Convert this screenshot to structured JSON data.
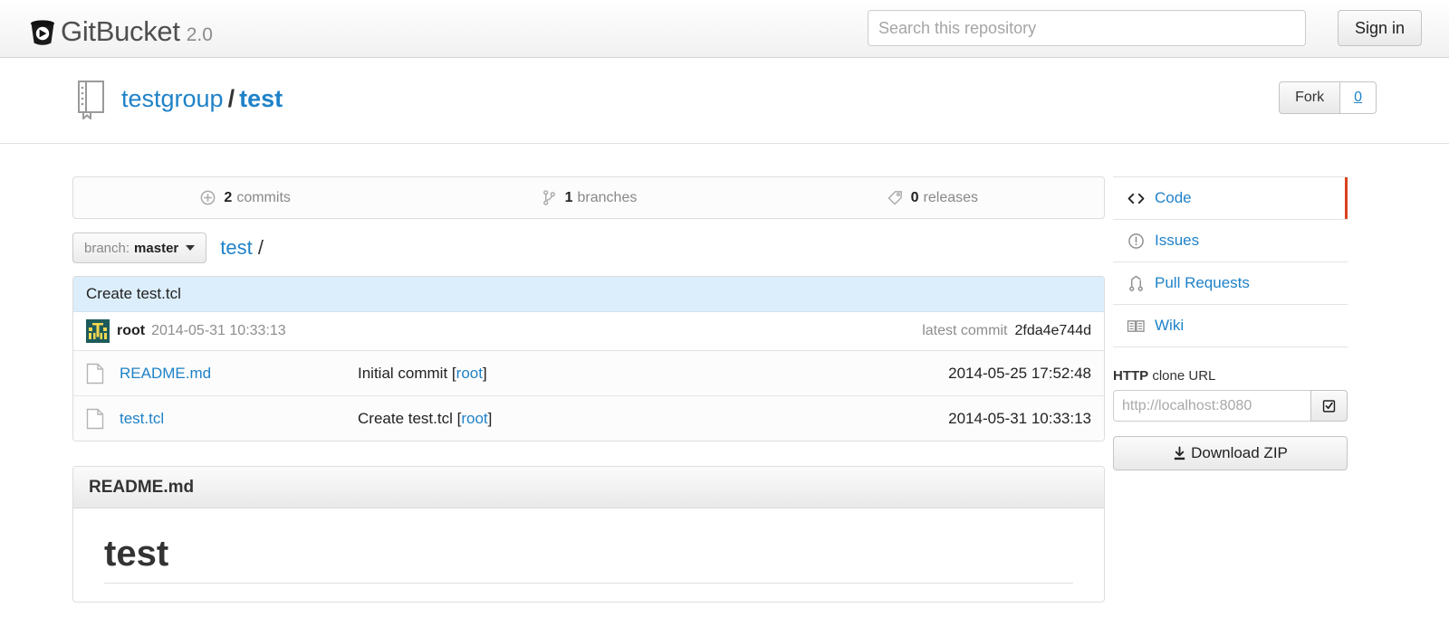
{
  "header": {
    "brand_name": "GitBucket",
    "brand_version": "2.0",
    "logo_icon": "gitbucket-logo-icon",
    "search_placeholder": "Search this repository",
    "search_value": "",
    "signin_label": "Sign in"
  },
  "repo": {
    "icon": "repository-book-icon",
    "owner": "testgroup",
    "separator": "/",
    "name": "test",
    "fork_label": "Fork",
    "fork_count": "0"
  },
  "stats": [
    {
      "icon": "commit-clock-icon",
      "count": "2",
      "label": "commits"
    },
    {
      "icon": "branch-icon",
      "count": "1",
      "label": "branches"
    },
    {
      "icon": "tag-icon",
      "count": "0",
      "label": "releases"
    }
  ],
  "branch_bar": {
    "prefix": "branch:",
    "branch": "master",
    "path_root": "test",
    "path_slash": "/"
  },
  "commit": {
    "message": "Create test.tcl",
    "avatar_icon": "identicon-avatar",
    "author": "root",
    "date": "2014-05-31 10:33:13",
    "latest_commit_label": "latest commit",
    "latest_commit_hash": "2fda4e744d"
  },
  "files": {
    "rows": [
      {
        "icon": "file-icon",
        "name": "README.md",
        "message": "Initial commit ",
        "message_author_open": "[",
        "message_author": "root",
        "message_author_close": "]",
        "date": "2014-05-25 17:52:48"
      },
      {
        "icon": "file-icon",
        "name": "test.tcl",
        "message": "Create test.tcl ",
        "message_author_open": "[",
        "message_author": "root",
        "message_author_close": "]",
        "date": "2014-05-31 10:33:13"
      }
    ]
  },
  "readme": {
    "title": "README.md",
    "heading": "test"
  },
  "sidebar": {
    "items": [
      {
        "icon": "code-brackets-icon",
        "label": "Code",
        "active": true
      },
      {
        "icon": "issue-exclamation-icon",
        "label": "Issues",
        "active": false
      },
      {
        "icon": "pull-request-icon",
        "label": "Pull Requests",
        "active": false
      },
      {
        "icon": "wiki-book-icon",
        "label": "Wiki",
        "active": false
      }
    ],
    "clone": {
      "label_bold": "HTTP",
      "label_rest": " clone URL",
      "url_value": "http://localhost:8080",
      "copy_icon": "clipboard-check-icon"
    },
    "download": {
      "icon": "download-icon",
      "label": "Download ZIP"
    }
  },
  "colors": {
    "link": "#1f82c8",
    "active_marker": "#d9411e",
    "commit_banner": "#dceefb",
    "avatar_bg": "#1d5b5b",
    "avatar_fg": "#f2d750"
  }
}
